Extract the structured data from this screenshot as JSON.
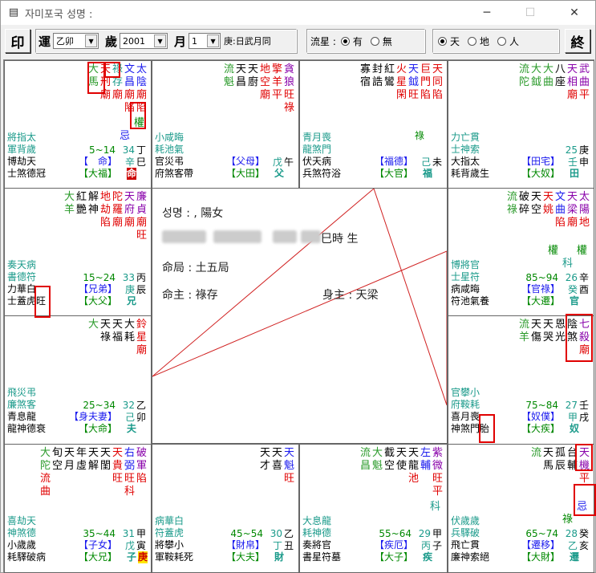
{
  "window": {
    "title": "자미포국   성명 :"
  },
  "toolbar": {
    "print_label": "印",
    "yun_label": "運",
    "yun_value": "乙卯",
    "sui_label": "歲",
    "sui_value": "2001",
    "yue_label": "月",
    "yue_value": "1",
    "ganzhi": "庚:日武月同",
    "liuxing_label": "流星 :",
    "liu_opts": [
      "有",
      "無"
    ],
    "liu_selected": "有",
    "mode_opts": [
      "天",
      "地",
      "人"
    ],
    "mode_selected": "天",
    "end_label": "終"
  },
  "center": {
    "name_line": "성명 : , 陽女",
    "birth_suffix": "巳時 生",
    "ming_ju": "命局 : 土五局",
    "ming_zhu": "命主 : 祿存",
    "shen_zhu": "身主 : 天梁"
  },
  "palaces": [
    {
      "id": "p-si",
      "stars": [
        [
          "太",
          "陰",
          "廟",
          "陷"
        ],
        [
          "文",
          "昌",
          "廟",
          "陷"
        ],
        [
          "祿",
          "存",
          "廟"
        ],
        [
          "天",
          "刑",
          "廟"
        ],
        [
          "大",
          "馬"
        ]
      ],
      "colors": [
        "b",
        "b",
        "t",
        "r",
        "g"
      ],
      "extra": [
        "權",
        "忌"
      ],
      "left1": "將指太",
      "left2": "軍背歲",
      "left3": "博劫天",
      "left4": "士煞德冠",
      "range": "5~14",
      "num": "34",
      "gz1": "辛",
      "gz2": "丁",
      "br": "巳",
      "pal": "【　命】",
      "pal2": "【大福】",
      "tag": "命"
    },
    {
      "id": "p-wu",
      "stars": [
        [
          "貪",
          "狼",
          "旺",
          "祿"
        ],
        [
          "擎",
          "羊",
          "平"
        ],
        [
          "地",
          "空",
          "廟"
        ],
        [
          "天",
          "廚"
        ],
        [
          "天",
          "昌"
        ],
        [
          "流",
          "魁"
        ]
      ],
      "colors": [
        "p",
        "r",
        "r",
        "k",
        "k",
        "g"
      ],
      "left1": "小咸晦",
      "left2": "耗池氣",
      "left3": "官災弔",
      "left4": "府煞客帶",
      "gz1": "戊",
      "br": "午",
      "pal": "【父母】",
      "pal2": "【大田】",
      "tag": "父"
    },
    {
      "id": "p-wei",
      "stars": [
        [
          "天",
          "同",
          "陷"
        ],
        [
          "巨",
          "門",
          "陷"
        ],
        [
          "天",
          "鉞",
          "旺"
        ],
        [
          "火",
          "星",
          "閑"
        ],
        [
          "紅",
          "鸞"
        ],
        [
          "封",
          "誥"
        ],
        [
          "寡",
          "宿"
        ]
      ],
      "colors": [
        "r",
        "r",
        "b",
        "r",
        "k",
        "k",
        "k"
      ],
      "left1": "青月喪",
      "left2": "龍煞門",
      "left3": "伏天病",
      "left4": "兵煞符浴",
      "gz1": "己",
      "br": "未",
      "pal": "【福德】",
      "pal2": "【大官】",
      "tag": "福",
      "flag": "祿"
    },
    {
      "id": "p-shen",
      "stars": [
        [
          "武",
          "曲",
          "平"
        ],
        [
          "天",
          "相",
          "廟"
        ],
        [
          "八",
          "座"
        ],
        [
          "大",
          "曲"
        ],
        [
          "大",
          "鉞"
        ],
        [
          "流",
          "陀"
        ]
      ],
      "colors": [
        "p",
        "p",
        "k",
        "g",
        "g",
        "g"
      ],
      "left1": "力亡貫",
      "left2": "士神索",
      "left3": "大指太",
      "left4": "耗背歲生",
      "num": "25",
      "gz1": "壬",
      "gz2": "庚",
      "br": "申",
      "pal": "【田宅】",
      "pal2": "【大奴】",
      "tag": "田"
    },
    {
      "id": "p-chen",
      "stars": [
        [
          "廉",
          "貞",
          "廟",
          "旺"
        ],
        [
          "天",
          "府",
          "廟"
        ],
        [
          "陀",
          "羅",
          "廟"
        ],
        [
          "地",
          "劫",
          "陷"
        ],
        [
          "解",
          "神"
        ],
        [
          "紅",
          "艷"
        ],
        [
          "大",
          "羊"
        ]
      ],
      "colors": [
        "p",
        "p",
        "r",
        "r",
        "k",
        "k",
        "g"
      ],
      "left1": "奏天病",
      "left2": "書德符",
      "left3": "力華白",
      "left4": "士蓋虎旺",
      "range": "15~24",
      "num": "33",
      "gz1": "庚",
      "gz2": "丙",
      "br": "辰",
      "pal": "【兄弟】",
      "pal2": "【大父】",
      "tag": "兄"
    },
    {
      "id": "p-you",
      "stars": [
        [
          "太",
          "陽",
          "地"
        ],
        [
          "天",
          "梁",
          "廟"
        ],
        [
          "文",
          "曲",
          "陷"
        ],
        [
          "天",
          "姚"
        ],
        [
          "天",
          "空"
        ],
        [
          "破",
          "碎"
        ],
        [
          "流",
          "祿"
        ]
      ],
      "colors": [
        "p",
        "p",
        "b",
        "r",
        "k",
        "k",
        "g"
      ],
      "extra": [
        "權",
        "科",
        "權"
      ],
      "left1": "博將官",
      "left2": "士星符",
      "left3": "病咸晦",
      "left4": "符池氣養",
      "range": "85~94",
      "num": "26",
      "gz1": "癸",
      "gz2": "辛",
      "br": "酉",
      "pal": "【官祿】",
      "pal2": "【大遷】",
      "tag": "官"
    },
    {
      "id": "p-mao",
      "stars": [
        [
          "鈴",
          "星",
          "廟"
        ],
        [
          "大",
          "耗"
        ],
        [
          "天",
          "福"
        ],
        [
          "天",
          "祿"
        ],
        [
          "大"
        ]
      ],
      "colors": [
        "r",
        "k",
        "k",
        "k",
        "g"
      ],
      "left1": "飛災弔",
      "left2": "廉煞客",
      "left3": "青息龍",
      "left4": "龍神德衰",
      "range": "25~34",
      "num": "32",
      "gz1": "己",
      "gz2": "乙",
      "br": "卯",
      "pal": "【身夫妻】",
      "pal2": "【大命】",
      "tag": "夫"
    },
    {
      "id": "p-xu",
      "stars": [
        [
          "七",
          "殺",
          "廟"
        ],
        [
          "陰",
          "煞"
        ],
        [
          "恩",
          "光"
        ],
        [
          "天",
          "哭"
        ],
        [
          "天",
          "傷"
        ],
        [
          "流",
          "羊"
        ]
      ],
      "colors": [
        "p",
        "k",
        "k",
        "k",
        "k",
        "g"
      ],
      "left1": "官攀小",
      "left2": "府鞍耗",
      "left3": "喜月喪",
      "left4": "神煞門胎",
      "range": "75~84",
      "num": "27",
      "gz1": "甲",
      "gz2": "壬",
      "br": "戌",
      "pal": "【奴僕】",
      "pal2": "【大疾】",
      "tag": "奴"
    },
    {
      "id": "p-yin",
      "stars": [
        [
          "破",
          "軍",
          "陷"
        ],
        [
          "右",
          "弼",
          "旺",
          "科"
        ],
        [
          "天",
          "貴",
          "旺"
        ],
        [
          "天",
          "閨"
        ],
        [
          "天",
          "解"
        ],
        [
          "年",
          "虛"
        ],
        [
          "天",
          "月"
        ],
        [
          "旬",
          "空"
        ],
        [
          "大",
          "陀",
          "流",
          "曲"
        ]
      ],
      "colors": [
        "p",
        "b",
        "r",
        "k",
        "k",
        "k",
        "k",
        "k",
        "g"
      ],
      "left1": "喜劫天",
      "left2": "神煞德",
      "left3": "小歲歲",
      "left4": "耗驛破病",
      "range": "35~44",
      "num": "31",
      "gz1": "戊",
      "gz2": "甲",
      "br": "寅",
      "pal": "【子女】",
      "pal2": "【大兄】",
      "tag": "子",
      "tag2": "庚"
    },
    {
      "id": "p-chou",
      "stars": [
        [
          "天",
          "魁",
          "旺"
        ],
        [
          "天",
          "喜"
        ],
        [
          "天",
          "才"
        ]
      ],
      "colors": [
        "b",
        "k",
        "k"
      ],
      "left1": "病華白",
      "left2": "符蓋虎",
      "left3": "將攀小",
      "left4": "軍鞍耗死",
      "range": "45~54",
      "num": "30",
      "gz1": "丁",
      "gz2": "乙",
      "br": "丑",
      "pal": "【財帛】",
      "pal2": "【大夫】",
      "tag": "財"
    },
    {
      "id": "p-zi",
      "stars": [
        [
          "紫",
          "微",
          "旺",
          "平"
        ],
        [
          "左",
          "輔"
        ],
        [
          "天",
          "龍",
          "池"
        ],
        [
          "天",
          "使"
        ],
        [
          "截",
          "空"
        ],
        [
          "大",
          "魁"
        ],
        [
          "流",
          "昌"
        ]
      ],
      "colors": [
        "p",
        "b",
        "k",
        "k",
        "k",
        "g",
        "g"
      ],
      "extra": [
        "科"
      ],
      "left1": "大息龍",
      "left2": "耗神德",
      "left3": "奏將官",
      "left4": "書星符墓",
      "range": "55~64",
      "num": "29",
      "gz1": "丙",
      "gz2": "甲",
      "br": "子",
      "pal": "【疾厄】",
      "pal2": "【大子】",
      "tag": "疾"
    },
    {
      "id": "p-hai",
      "stars": [
        [
          "天",
          "機",
          "平"
        ],
        [
          "台",
          "輔"
        ],
        [
          "孤",
          "辰"
        ],
        [
          "天",
          "馬"
        ],
        [
          "流"
        ]
      ],
      "colors": [
        "p",
        "k",
        "k",
        "k",
        "g"
      ],
      "extra": [
        "忌",
        "祿"
      ],
      "left1": "伏歲歲",
      "left2": "兵驛破",
      "left3": "飛亡貫",
      "left4": "廉神索絕",
      "range": "65~74",
      "num": "28",
      "gz1": "乙",
      "gz2": "癸",
      "br": "亥",
      "pal": "【遷移】",
      "pal2": "【大財】",
      "tag": "遷"
    }
  ]
}
